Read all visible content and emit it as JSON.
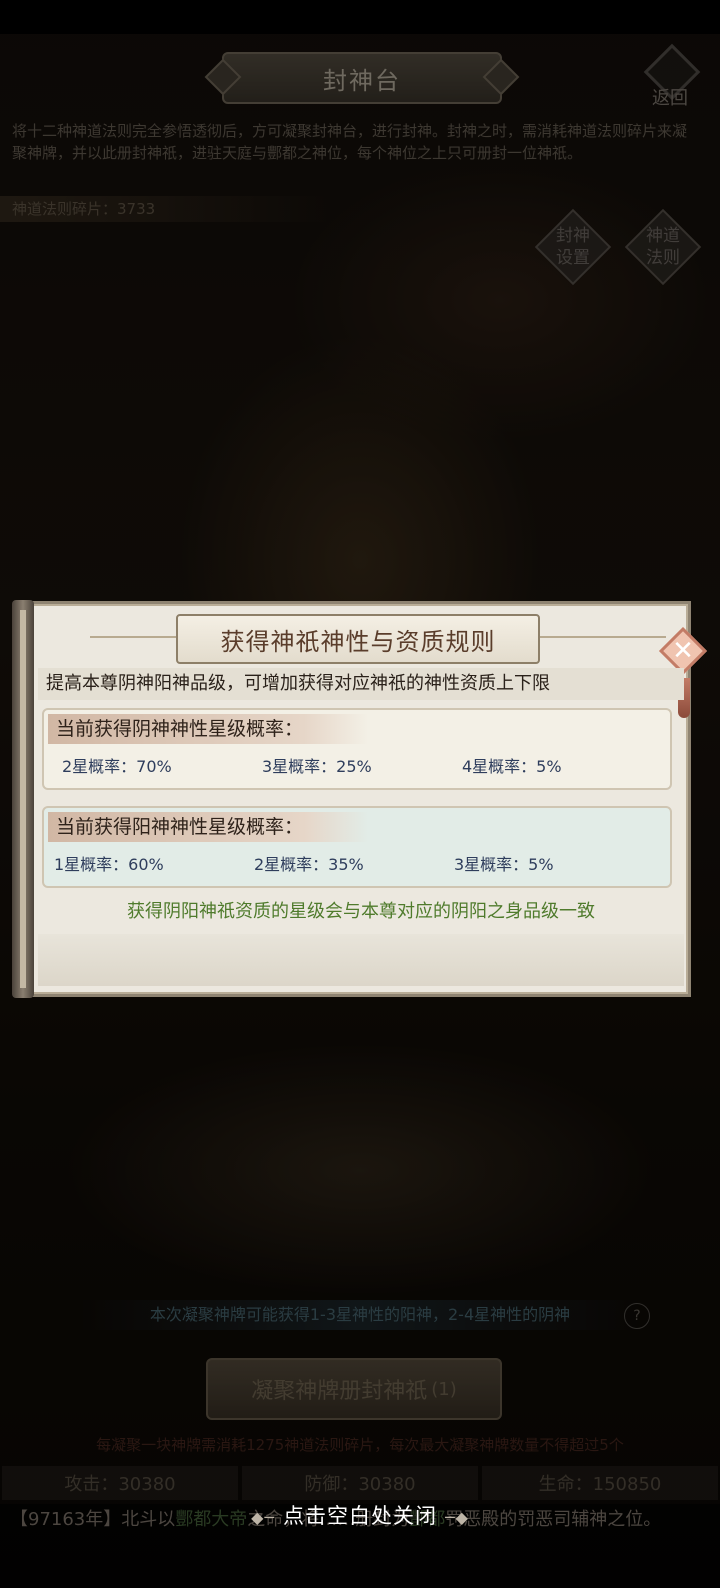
{
  "header": {
    "title": "封神台",
    "back_label": "返回"
  },
  "description": "将十二种神道法则完全参悟透彻后，方可凝聚封神台，进行封神。封神之时，需消耗神道法则碎片来凝聚神牌，并以此册封神祇，进驻天庭与酆都之神位，每个神位之上只可册封一位神祇。",
  "shard_count": "神道法则碎片：3733",
  "side_buttons": {
    "settings": "封神设置",
    "rules": "神道法则"
  },
  "hint": "本次凝聚神牌可能获得1-3星神性的阳神，2-4星神性的阴神",
  "hint_icon": "?",
  "main_button": {
    "label": "凝聚神牌册封神祇",
    "count": "(1)"
  },
  "cost_note": "每凝聚一块神牌需消耗1275神道法则碎片，每次最大凝聚神牌数量不得超过5个",
  "stats": {
    "attack": "攻击：30380",
    "defense": "防御：30380",
    "hp": "生命：150850"
  },
  "news": {
    "prefix": "【97163年】北斗以",
    "hl1": "酆都大帝",
    "mid": "之命，将",
    "obscured": "……",
    "mid2": "册封为",
    "hl2": "酆都",
    "tail": "罚恶殿的罚恶司辅神之位。"
  },
  "close_hint": "点击空白处关闭",
  "dialog": {
    "title": "获得神祇神性与资质规则",
    "intro": "提高本尊阴神阳神品级，可增加获得对应神祇的神性资质上下限",
    "yin": {
      "heading": "当前获得阴神神性星级概率：",
      "rates": [
        "2星概率：70%",
        "3星概率：25%",
        "4星概率：5%"
      ]
    },
    "yang": {
      "heading": "当前获得阳神神性星级概率：",
      "rates": [
        "1星概率：60%",
        "2星概率：35%",
        "3星概率：5%"
      ]
    },
    "footer": "获得阴阳神祇资质的星级会与本尊对应的阴阳之身品级一致"
  },
  "colors": {
    "dialog_bg": "#ece8df",
    "yang_card_bg": "#e2ece7",
    "footer_green": "#4f7b2c",
    "close_accent": "#c37c66"
  }
}
